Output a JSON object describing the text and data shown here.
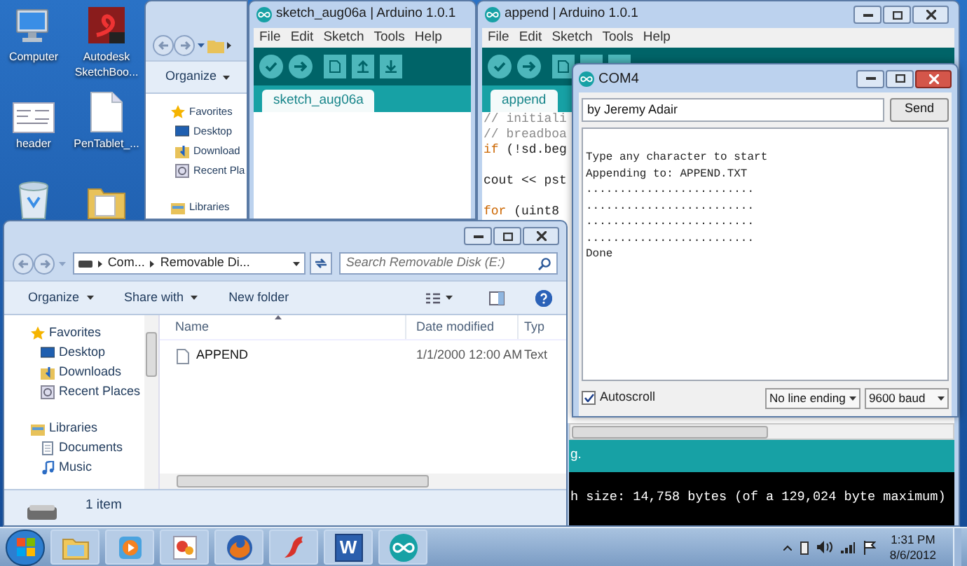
{
  "desktop_icons": [
    {
      "kind": "computer",
      "label": "Computer"
    },
    {
      "kind": "sketchbook",
      "label": "Autodesk SketchBoo..."
    },
    {
      "kind": "image",
      "label": "header"
    },
    {
      "kind": "file",
      "label": "PenTablet_..."
    },
    {
      "kind": "recycle"
    },
    {
      "kind": "folder"
    }
  ],
  "explorer_back": {
    "toolbar": [
      {
        "label": "Organize",
        "kind": "menu"
      }
    ],
    "nav": [
      {
        "label": "Favorites",
        "kind": "favorites",
        "children": [
          {
            "label": "Desktop",
            "kind": "desktop"
          },
          {
            "label": "Download",
            "kind": "downloads"
          },
          {
            "label": "Recent Pla",
            "kind": "recent"
          }
        ]
      },
      {
        "label": "Libraries",
        "kind": "libraries"
      }
    ]
  },
  "sketch_window": {
    "title": "sketch_aug06a | Arduino 1.0.1",
    "menu": [
      "File",
      "Edit",
      "Sketch",
      "Tools",
      "Help"
    ],
    "tabs": [
      {
        "label": "sketch_aug06a",
        "selected": true
      }
    ]
  },
  "append_window": {
    "title": "append | Arduino 1.0.1",
    "active": false,
    "menu": [
      "File",
      "Edit",
      "Sketch",
      "Tools",
      "Help"
    ],
    "tabs": [
      {
        "label": "append",
        "selected": true
      }
    ],
    "code": [
      {
        "kind": "comment",
        "text": "// initiali"
      },
      {
        "kind": "comment",
        "text": "// breadboa"
      },
      {
        "kind": "code",
        "keyword": "if",
        "text": " (!sd.beg"
      },
      {
        "kind": "blank"
      },
      {
        "kind": "code",
        "text": "cout << pst"
      },
      {
        "kind": "blank"
      },
      {
        "kind": "code",
        "keyword": "for",
        "text": " (uint8"
      }
    ],
    "status": "g.",
    "console": "h size: 14,758 bytes (of a 129,024 byte maximum)"
  },
  "serial_monitor": {
    "title": "COM4",
    "active": true,
    "input": {
      "value": "by Jeremy Adair"
    },
    "send": "Send",
    "output": [
      "Type any character to start",
      "Appending to: APPEND.TXT",
      ".........................",
      ".........................",
      ".........................",
      ".........................",
      "Done"
    ],
    "autoscroll": {
      "label": "Autoscroll",
      "checked": true
    },
    "line_ending": "No line ending",
    "baud": "9600 baud"
  },
  "explorer_front": {
    "active": false,
    "address": [
      "Com...",
      "Removable Di..."
    ],
    "search": {
      "placeholder": "Search Removable Disk (E:)"
    },
    "toolbar": [
      {
        "label": "Organize",
        "kind": "menu"
      },
      {
        "label": "Share with",
        "kind": "menu"
      },
      {
        "label": "New folder",
        "kind": "button"
      }
    ],
    "nav": [
      {
        "label": "Favorites",
        "kind": "favorites",
        "children": [
          {
            "label": "Desktop",
            "kind": "desktop"
          },
          {
            "label": "Downloads",
            "kind": "downloads"
          },
          {
            "label": "Recent Places",
            "kind": "recent"
          }
        ]
      },
      {
        "label": "Libraries",
        "kind": "libraries",
        "children": [
          {
            "label": "Documents",
            "kind": "documents"
          },
          {
            "label": "Music",
            "kind": "music"
          }
        ]
      }
    ],
    "columns": [
      "Name",
      "Date modified",
      "Typ"
    ],
    "rows": [
      {
        "name": "APPEND",
        "date": "1/1/2000 12:00 AM",
        "type": "Text"
      }
    ],
    "status": "1 item"
  },
  "taskbar": {
    "apps": [
      {
        "kind": "explorer"
      },
      {
        "kind": "media"
      },
      {
        "kind": "paint"
      },
      {
        "kind": "firefox"
      },
      {
        "kind": "bird"
      },
      {
        "kind": "word",
        "label": "W"
      },
      {
        "kind": "arduino"
      }
    ],
    "time": "1:31 PM",
    "date": "8/6/2012"
  }
}
